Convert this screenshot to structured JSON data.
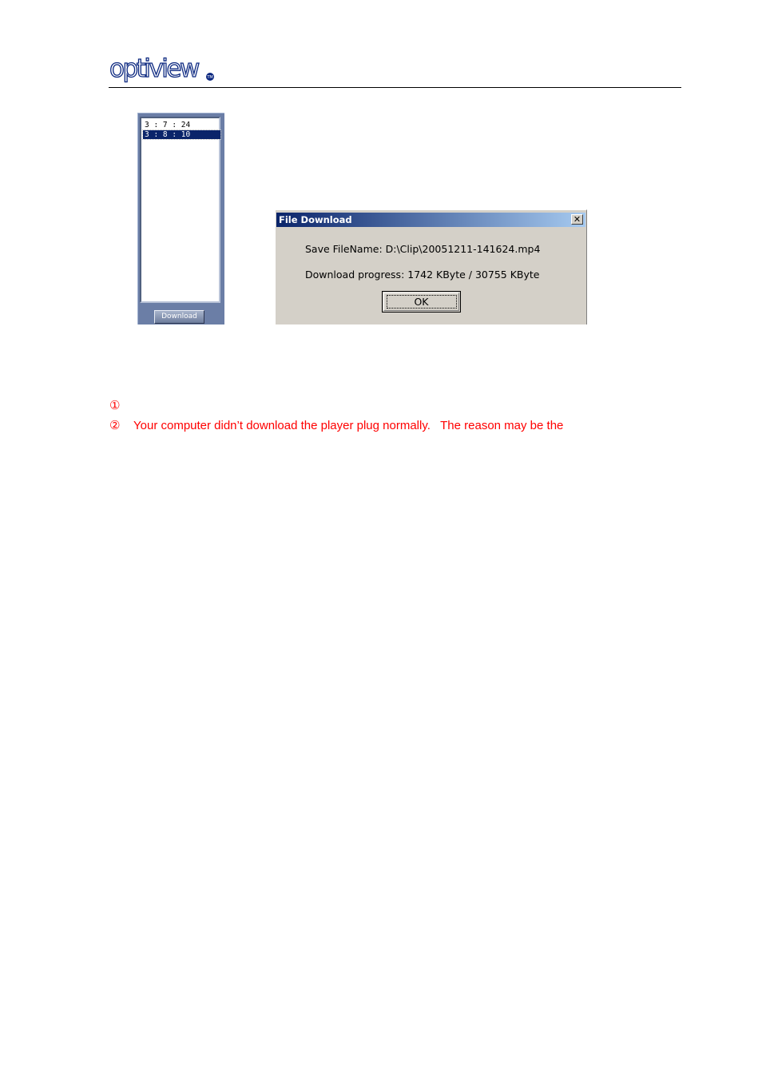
{
  "header": {
    "logo_text": "optiview",
    "logo_mark": "TM"
  },
  "clip_panel": {
    "items": [
      {
        "label": "3 : 7 : 24",
        "selected": false
      },
      {
        "label": "3 : 8 : 10",
        "selected": true
      }
    ],
    "download_label": "Download"
  },
  "dialog": {
    "title": "File Download",
    "close_symbol": "✕",
    "filename_line": "Save FileName: D:\\Clip\\20051211-141624.mp4",
    "progress_line": "Download progress: 1742 KByte / 30755 KByte",
    "ok_label": "OK"
  },
  "notes": [
    {
      "marker": "①",
      "text": ""
    },
    {
      "marker": "②",
      "text": "Your computer didn’t download the player plug normally.   The reason may be the"
    }
  ],
  "colors": {
    "note_text": "#ff0000",
    "titlebar_start": "#0a246a",
    "titlebar_end": "#a6caf0",
    "dialog_face": "#d4d0c8",
    "panel_bg": "#6b7ea6"
  }
}
